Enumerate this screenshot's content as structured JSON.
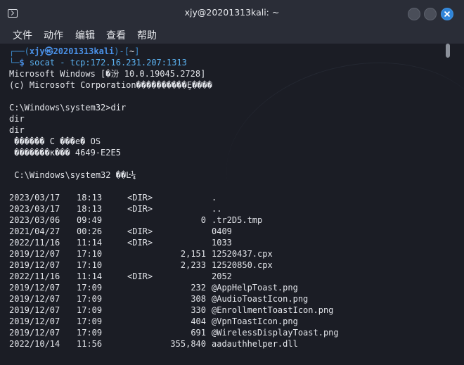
{
  "window": {
    "title": "xjy@20201313kali: ~"
  },
  "menu": [
    "文件",
    "动作",
    "编辑",
    "查看",
    "帮助"
  ],
  "prompt": {
    "open": "┌──(",
    "user_host": "xjy㉿20201313kali",
    "close": ")-[",
    "path": "~",
    "close2": "]",
    "line2_prefix": "└─",
    "symbol": "$",
    "command": "socat - tcp:172.16.231.207:1313"
  },
  "output": [
    "Microsoft Windows [�汾 10.0.19045.2728]",
    "(c) Microsoft Corporation����������Ȩ����",
    "",
    "C:\\Windows\\system32>dir",
    "dir",
    "dir",
    " ������ C ���е� OS",
    " �������к��� 4649-E2E5",
    "",
    " C:\\Windows\\system32 ��Ŀ¼",
    ""
  ],
  "listing": [
    {
      "date": "2023/03/17",
      "time": "18:13",
      "dir": "<DIR>",
      "size": "",
      "name": "."
    },
    {
      "date": "2023/03/17",
      "time": "18:13",
      "dir": "<DIR>",
      "size": "",
      "name": ".."
    },
    {
      "date": "2023/03/06",
      "time": "09:49",
      "dir": "",
      "size": "0",
      "name": ".tr2D5.tmp"
    },
    {
      "date": "2021/04/27",
      "time": "00:26",
      "dir": "<DIR>",
      "size": "",
      "name": "0409"
    },
    {
      "date": "2022/11/16",
      "time": "11:14",
      "dir": "<DIR>",
      "size": "",
      "name": "1033"
    },
    {
      "date": "2019/12/07",
      "time": "17:10",
      "dir": "",
      "size": "2,151",
      "name": "12520437.cpx"
    },
    {
      "date": "2019/12/07",
      "time": "17:10",
      "dir": "",
      "size": "2,233",
      "name": "12520850.cpx"
    },
    {
      "date": "2022/11/16",
      "time": "11:14",
      "dir": "<DIR>",
      "size": "",
      "name": "2052"
    },
    {
      "date": "2019/12/07",
      "time": "17:09",
      "dir": "",
      "size": "232",
      "name": "@AppHelpToast.png"
    },
    {
      "date": "2019/12/07",
      "time": "17:09",
      "dir": "",
      "size": "308",
      "name": "@AudioToastIcon.png"
    },
    {
      "date": "2019/12/07",
      "time": "17:09",
      "dir": "",
      "size": "330",
      "name": "@EnrollmentToastIcon.png"
    },
    {
      "date": "2019/12/07",
      "time": "17:09",
      "dir": "",
      "size": "404",
      "name": "@VpnToastIcon.png"
    },
    {
      "date": "2019/12/07",
      "time": "17:09",
      "dir": "",
      "size": "691",
      "name": "@WirelessDisplayToast.png"
    },
    {
      "date": "2022/10/14",
      "time": "11:56",
      "dir": "",
      "size": "355,840",
      "name": "aadauthhelper.dll"
    }
  ]
}
